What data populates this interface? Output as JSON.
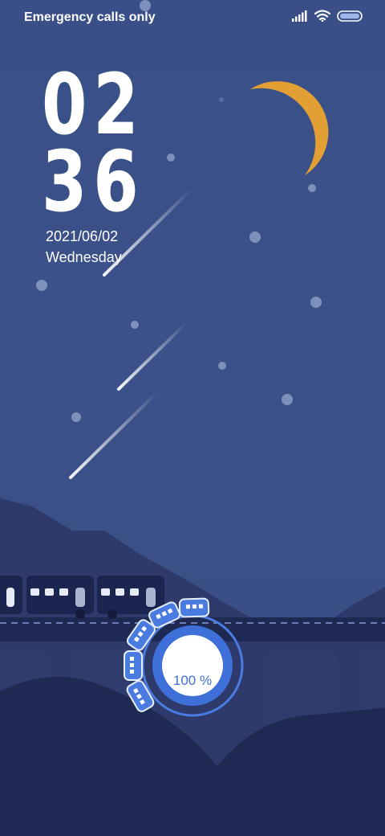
{
  "status_bar": {
    "carrier_text": "Emergency calls only",
    "icons": [
      "signal-icon",
      "wifi-icon",
      "battery-icon"
    ]
  },
  "lock_clock": {
    "hour": "02",
    "minute": "36",
    "date": "2021/06/02",
    "weekday": "Wednesday"
  },
  "charging": {
    "percent_label": "100 %",
    "level": 1.0
  },
  "colors": {
    "sky": "#3c5189",
    "moon": "#e2a034",
    "mountain_far": "#2d3a6b",
    "bridge": "#1f2a52",
    "train": "#1c2450",
    "accent_blue": "#3f6fd8"
  }
}
